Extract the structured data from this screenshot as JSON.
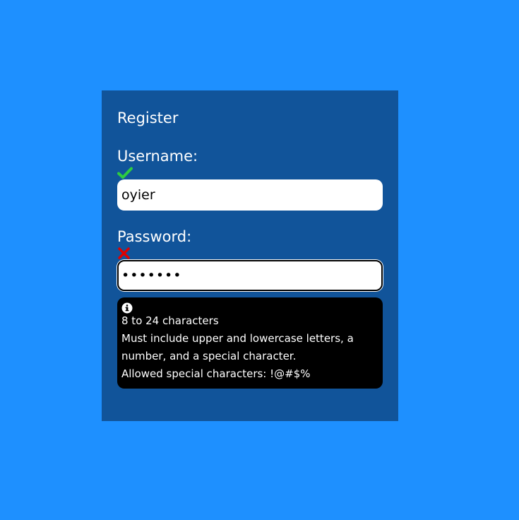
{
  "form": {
    "title": "Register",
    "username": {
      "label": "Username:",
      "value": "oyier",
      "valid": true,
      "status_icon": "check-icon"
    },
    "password": {
      "label": "Password:",
      "masked_value": "•••••••",
      "valid": false,
      "status_icon": "cross-icon"
    },
    "hint": {
      "icon": "info-circle-icon",
      "lines": [
        "8 to 24 characters",
        "Must include upper and lowercase letters, a",
        "number, and a special character.",
        "Allowed special characters: !@#$%"
      ]
    }
  },
  "colors": {
    "page_background": "#1e90ff",
    "card_background": "#11549a",
    "valid": "#2ecc40",
    "invalid": "#e00000",
    "hint_background": "#000000"
  }
}
